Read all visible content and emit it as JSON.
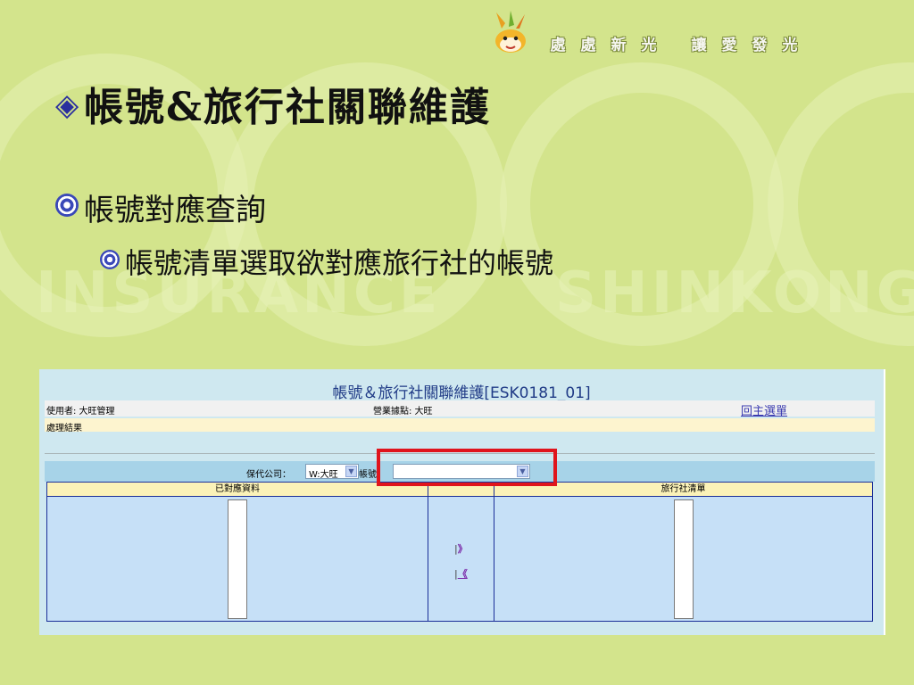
{
  "slide": {
    "slogan": [
      "處",
      "處",
      "新",
      "光",
      "讓",
      "愛",
      "發",
      "光"
    ],
    "title": "帳號&旅行社關聯維護",
    "bullet_l1": "帳號對應查詢",
    "bullet_l2": "帳號清單選取欲對應旅行社的帳號",
    "background_words": [
      "INSURANCE",
      "SHINKONG"
    ]
  },
  "app": {
    "window_title": "帳號＆旅行社關聯維護[ESK0181_01]",
    "user_label": "使用者: 大旺管理",
    "branch_label": "營業據點: 大旺",
    "main_menu_link": "回主選單",
    "result_label": "處理結果",
    "filter": {
      "company_label": "保代公司：",
      "company_value": "W:大旺",
      "account_label": "帳號：",
      "account_value": ""
    },
    "columns": {
      "mapped": "已對應資料",
      "agency_list": "旅行社清單"
    },
    "move_right": "》",
    "move_left": "《"
  },
  "colors": {
    "slide_bg": "#d3e48c",
    "panel_bg": "#cfe8f0",
    "highlight": "#e0141c",
    "grid_border": "#1b2f98"
  }
}
